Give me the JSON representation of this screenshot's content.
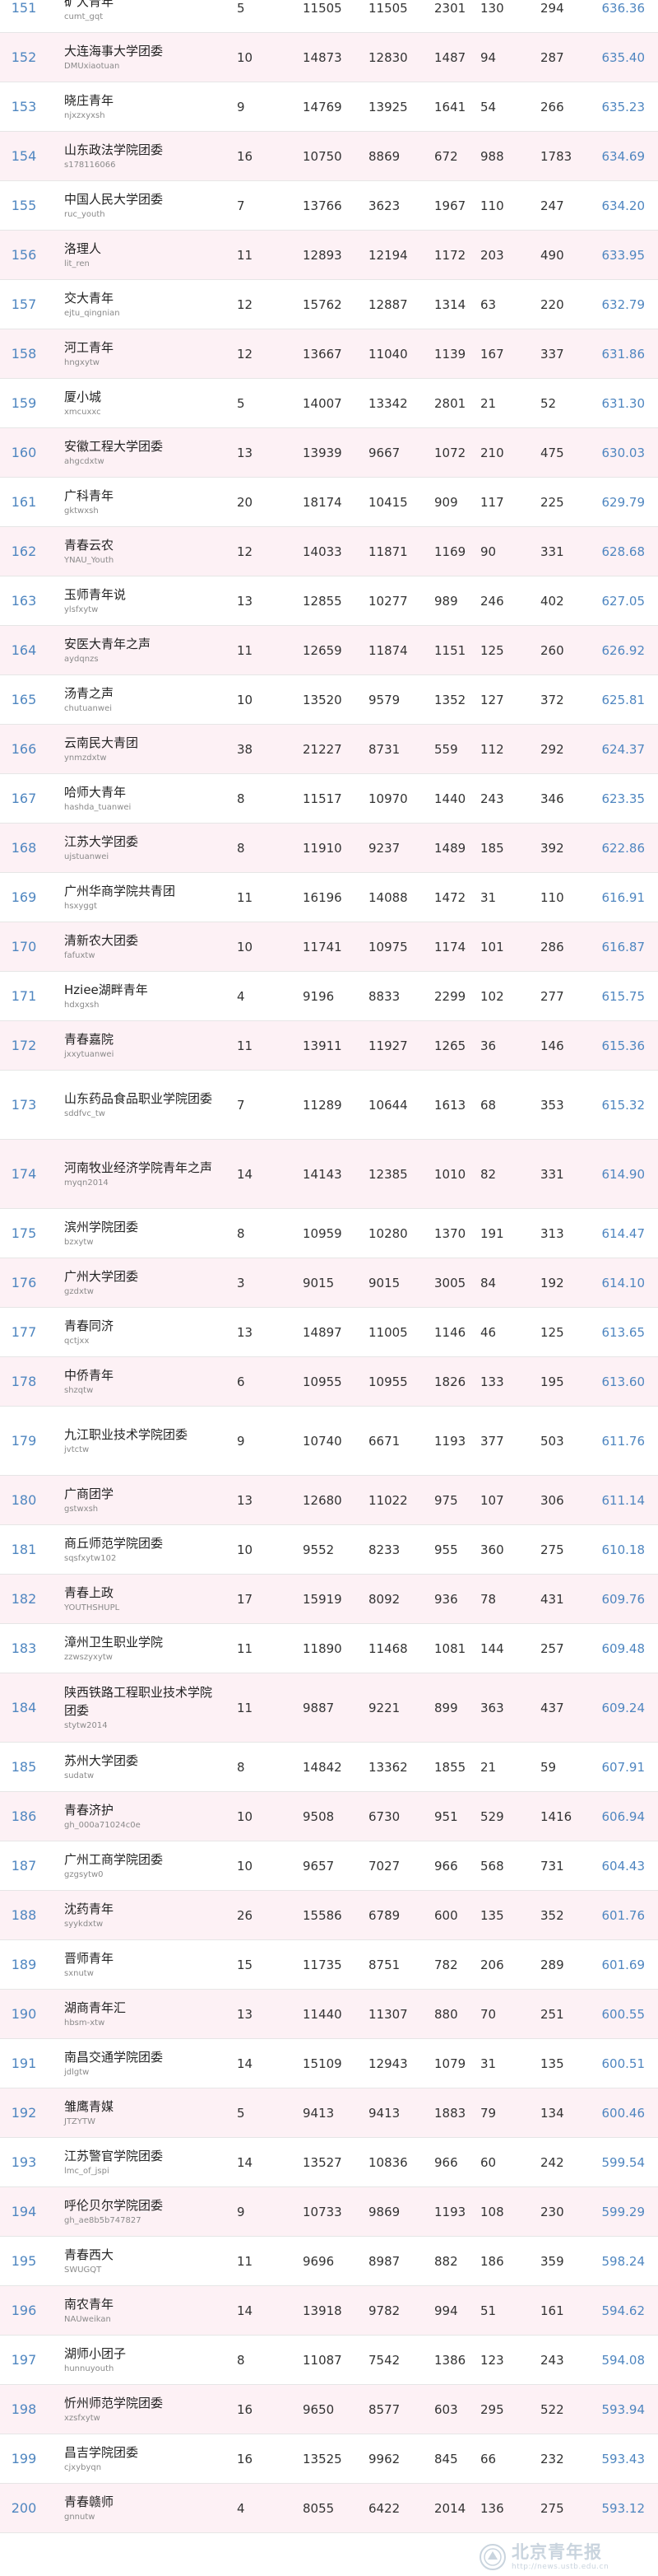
{
  "rows": [
    {
      "rank": "151",
      "name": "矿大青年",
      "id": "cumt_gqt",
      "a": "5",
      "b": "11505",
      "c": "11505",
      "d": "2301",
      "e": "130",
      "f": "294",
      "score": "636.36"
    },
    {
      "rank": "152",
      "name": "大连海事大学团委",
      "id": "DMUxiaotuan",
      "a": "10",
      "b": "14873",
      "c": "12830",
      "d": "1487",
      "e": "94",
      "f": "287",
      "score": "635.40"
    },
    {
      "rank": "153",
      "name": "晓庄青年",
      "id": "njxzxyxsh",
      "a": "9",
      "b": "14769",
      "c": "13925",
      "d": "1641",
      "e": "54",
      "f": "266",
      "score": "635.23"
    },
    {
      "rank": "154",
      "name": "山东政法学院团委",
      "id": "s178116066",
      "a": "16",
      "b": "10750",
      "c": "8869",
      "d": "672",
      "e": "988",
      "f": "1783",
      "score": "634.69"
    },
    {
      "rank": "155",
      "name": "中国人民大学团委",
      "id": "ruc_youth",
      "a": "7",
      "b": "13766",
      "c": "3623",
      "d": "1967",
      "e": "110",
      "f": "247",
      "score": "634.20"
    },
    {
      "rank": "156",
      "name": "洛理人",
      "id": "lit_ren",
      "a": "11",
      "b": "12893",
      "c": "12194",
      "d": "1172",
      "e": "203",
      "f": "490",
      "score": "633.95"
    },
    {
      "rank": "157",
      "name": "交大青年",
      "id": "ejtu_qingnian",
      "a": "12",
      "b": "15762",
      "c": "12887",
      "d": "1314",
      "e": "63",
      "f": "220",
      "score": "632.79"
    },
    {
      "rank": "158",
      "name": "河工青年",
      "id": "hngxytw",
      "a": "12",
      "b": "13667",
      "c": "11040",
      "d": "1139",
      "e": "167",
      "f": "337",
      "score": "631.86"
    },
    {
      "rank": "159",
      "name": "厦小城",
      "id": "xmcuxxc",
      "a": "5",
      "b": "14007",
      "c": "13342",
      "d": "2801",
      "e": "21",
      "f": "52",
      "score": "631.30"
    },
    {
      "rank": "160",
      "name": "安徽工程大学团委",
      "id": "ahgcdxtw",
      "a": "13",
      "b": "13939",
      "c": "9667",
      "d": "1072",
      "e": "210",
      "f": "475",
      "score": "630.03"
    },
    {
      "rank": "161",
      "name": "广科青年",
      "id": "gktwxsh",
      "a": "20",
      "b": "18174",
      "c": "10415",
      "d": "909",
      "e": "117",
      "f": "225",
      "score": "629.79"
    },
    {
      "rank": "162",
      "name": "青春云农",
      "id": "YNAU_Youth",
      "a": "12",
      "b": "14033",
      "c": "11871",
      "d": "1169",
      "e": "90",
      "f": "331",
      "score": "628.68"
    },
    {
      "rank": "163",
      "name": "玉师青年说",
      "id": "ylsfxytw",
      "a": "13",
      "b": "12855",
      "c": "10277",
      "d": "989",
      "e": "246",
      "f": "402",
      "score": "627.05"
    },
    {
      "rank": "164",
      "name": "安医大青年之声",
      "id": "aydqnzs",
      "a": "11",
      "b": "12659",
      "c": "11874",
      "d": "1151",
      "e": "125",
      "f": "260",
      "score": "626.92"
    },
    {
      "rank": "165",
      "name": "汤青之声",
      "id": "chutuanwei",
      "a": "10",
      "b": "13520",
      "c": "9579",
      "d": "1352",
      "e": "127",
      "f": "372",
      "score": "625.81"
    },
    {
      "rank": "166",
      "name": "云南民大青团",
      "id": "ynmzdxtw",
      "a": "38",
      "b": "21227",
      "c": "8731",
      "d": "559",
      "e": "112",
      "f": "292",
      "score": "624.37"
    },
    {
      "rank": "167",
      "name": "哈师大青年",
      "id": "hashda_tuanwei",
      "a": "8",
      "b": "11517",
      "c": "10970",
      "d": "1440",
      "e": "243",
      "f": "346",
      "score": "623.35"
    },
    {
      "rank": "168",
      "name": "江苏大学团委",
      "id": "ujstuanwei",
      "a": "8",
      "b": "11910",
      "c": "9237",
      "d": "1489",
      "e": "185",
      "f": "392",
      "score": "622.86"
    },
    {
      "rank": "169",
      "name": "广州华商学院共青团",
      "id": "hsxyggt",
      "a": "11",
      "b": "16196",
      "c": "14088",
      "d": "1472",
      "e": "31",
      "f": "110",
      "score": "616.91"
    },
    {
      "rank": "170",
      "name": "清新农大团委",
      "id": "fafuxtw",
      "a": "10",
      "b": "11741",
      "c": "10975",
      "d": "1174",
      "e": "101",
      "f": "286",
      "score": "616.87"
    },
    {
      "rank": "171",
      "name": "Hziee湖畔青年",
      "id": "hdxgxsh",
      "a": "4",
      "b": "9196",
      "c": "8833",
      "d": "2299",
      "e": "102",
      "f": "277",
      "score": "615.75"
    },
    {
      "rank": "172",
      "name": "青春嘉院",
      "id": "jxxytuanwei",
      "a": "11",
      "b": "13911",
      "c": "11927",
      "d": "1265",
      "e": "36",
      "f": "146",
      "score": "615.36"
    },
    {
      "rank": "173",
      "name": "山东药品食品职业学院团委",
      "id": "sddfvc_tw",
      "a": "7",
      "b": "11289",
      "c": "10644",
      "d": "1613",
      "e": "68",
      "f": "353",
      "score": "615.32"
    },
    {
      "rank": "174",
      "name": "河南牧业经济学院青年之声",
      "id": "myqn2014",
      "a": "14",
      "b": "14143",
      "c": "12385",
      "d": "1010",
      "e": "82",
      "f": "331",
      "score": "614.90"
    },
    {
      "rank": "175",
      "name": "滨州学院团委",
      "id": "bzxytw",
      "a": "8",
      "b": "10959",
      "c": "10280",
      "d": "1370",
      "e": "191",
      "f": "313",
      "score": "614.47"
    },
    {
      "rank": "176",
      "name": "广州大学团委",
      "id": "gzdxtw",
      "a": "3",
      "b": "9015",
      "c": "9015",
      "d": "3005",
      "e": "84",
      "f": "192",
      "score": "614.10"
    },
    {
      "rank": "177",
      "name": "青春同济",
      "id": "qctjxx",
      "a": "13",
      "b": "14897",
      "c": "11005",
      "d": "1146",
      "e": "46",
      "f": "125",
      "score": "613.65"
    },
    {
      "rank": "178",
      "name": "中侨青年",
      "id": "shzqtw",
      "a": "6",
      "b": "10955",
      "c": "10955",
      "d": "1826",
      "e": "133",
      "f": "195",
      "score": "613.60"
    },
    {
      "rank": "179",
      "name": "九江职业技术学院团委",
      "id": "jvtctw",
      "a": "9",
      "b": "10740",
      "c": "6671",
      "d": "1193",
      "e": "377",
      "f": "503",
      "score": "611.76"
    },
    {
      "rank": "180",
      "name": "广商团学",
      "id": "gstwxsh",
      "a": "13",
      "b": "12680",
      "c": "11022",
      "d": "975",
      "e": "107",
      "f": "306",
      "score": "611.14"
    },
    {
      "rank": "181",
      "name": "商丘师范学院团委",
      "id": "sqsfxytw102",
      "a": "10",
      "b": "9552",
      "c": "8233",
      "d": "955",
      "e": "360",
      "f": "275",
      "score": "610.18"
    },
    {
      "rank": "182",
      "name": "青春上政",
      "id": "YOUTHSHUPL",
      "a": "17",
      "b": "15919",
      "c": "8092",
      "d": "936",
      "e": "78",
      "f": "431",
      "score": "609.76"
    },
    {
      "rank": "183",
      "name": "漳州卫生职业学院",
      "id": "zzwszyxytw",
      "a": "11",
      "b": "11890",
      "c": "11468",
      "d": "1081",
      "e": "144",
      "f": "257",
      "score": "609.48"
    },
    {
      "rank": "184",
      "name": "陕西铁路工程职业技术学院团委",
      "id": "stytw2014",
      "a": "11",
      "b": "9887",
      "c": "9221",
      "d": "899",
      "e": "363",
      "f": "437",
      "score": "609.24"
    },
    {
      "rank": "185",
      "name": "苏州大学团委",
      "id": "sudatw",
      "a": "8",
      "b": "14842",
      "c": "13362",
      "d": "1855",
      "e": "21",
      "f": "59",
      "score": "607.91"
    },
    {
      "rank": "186",
      "name": "青春济护",
      "id": "gh_000a71024c0e",
      "a": "10",
      "b": "9508",
      "c": "6730",
      "d": "951",
      "e": "529",
      "f": "1416",
      "score": "606.94"
    },
    {
      "rank": "187",
      "name": "广州工商学院团委",
      "id": "gzgsytw0",
      "a": "10",
      "b": "9657",
      "c": "7027",
      "d": "966",
      "e": "568",
      "f": "731",
      "score": "604.43"
    },
    {
      "rank": "188",
      "name": "沈药青年",
      "id": "syykdxtw",
      "a": "26",
      "b": "15586",
      "c": "6789",
      "d": "600",
      "e": "135",
      "f": "352",
      "score": "601.76"
    },
    {
      "rank": "189",
      "name": "晋师青年",
      "id": "sxnutw",
      "a": "15",
      "b": "11735",
      "c": "8751",
      "d": "782",
      "e": "206",
      "f": "289",
      "score": "601.69"
    },
    {
      "rank": "190",
      "name": "湖商青年汇",
      "id": "hbsm-xtw",
      "a": "13",
      "b": "11440",
      "c": "11307",
      "d": "880",
      "e": "70",
      "f": "251",
      "score": "600.55"
    },
    {
      "rank": "191",
      "name": "南昌交通学院团委",
      "id": "jdlgtw",
      "a": "14",
      "b": "15109",
      "c": "12943",
      "d": "1079",
      "e": "31",
      "f": "135",
      "score": "600.51"
    },
    {
      "rank": "192",
      "name": "雏鹰青媒",
      "id": "JTZYTW",
      "a": "5",
      "b": "9413",
      "c": "9413",
      "d": "1883",
      "e": "79",
      "f": "134",
      "score": "600.46"
    },
    {
      "rank": "193",
      "name": "江苏警官学院团委",
      "id": "lmc_of_jspi",
      "a": "14",
      "b": "13527",
      "c": "10836",
      "d": "966",
      "e": "60",
      "f": "242",
      "score": "599.54"
    },
    {
      "rank": "194",
      "name": "呼伦贝尔学院团委",
      "id": "gh_ae8b5b747827",
      "a": "9",
      "b": "10733",
      "c": "9869",
      "d": "1193",
      "e": "108",
      "f": "230",
      "score": "599.29"
    },
    {
      "rank": "195",
      "name": "青春西大",
      "id": "SWUGQT",
      "a": "11",
      "b": "9696",
      "c": "8987",
      "d": "882",
      "e": "186",
      "f": "359",
      "score": "598.24"
    },
    {
      "rank": "196",
      "name": "南农青年",
      "id": "NAUweikan",
      "a": "14",
      "b": "13918",
      "c": "9782",
      "d": "994",
      "e": "51",
      "f": "161",
      "score": "594.62"
    },
    {
      "rank": "197",
      "name": "湖师小团子",
      "id": "hunnuyouth",
      "a": "8",
      "b": "11087",
      "c": "7542",
      "d": "1386",
      "e": "123",
      "f": "243",
      "score": "594.08"
    },
    {
      "rank": "198",
      "name": "忻州师范学院团委",
      "id": "xzsfxytw",
      "a": "16",
      "b": "9650",
      "c": "8577",
      "d": "603",
      "e": "295",
      "f": "522",
      "score": "593.94"
    },
    {
      "rank": "199",
      "name": "昌吉学院团委",
      "id": "cjxybyqn",
      "a": "16",
      "b": "13525",
      "c": "9962",
      "d": "845",
      "e": "66",
      "f": "232",
      "score": "593.43"
    },
    {
      "rank": "200",
      "name": "青春赣师",
      "id": "gnnutw",
      "a": "4",
      "b": "8055",
      "c": "6422",
      "d": "2014",
      "e": "136",
      "f": "275",
      "score": "593.12"
    }
  ],
  "watermark": {
    "title": "北京青年报",
    "url": "http://news.ustb.edu.cn"
  }
}
